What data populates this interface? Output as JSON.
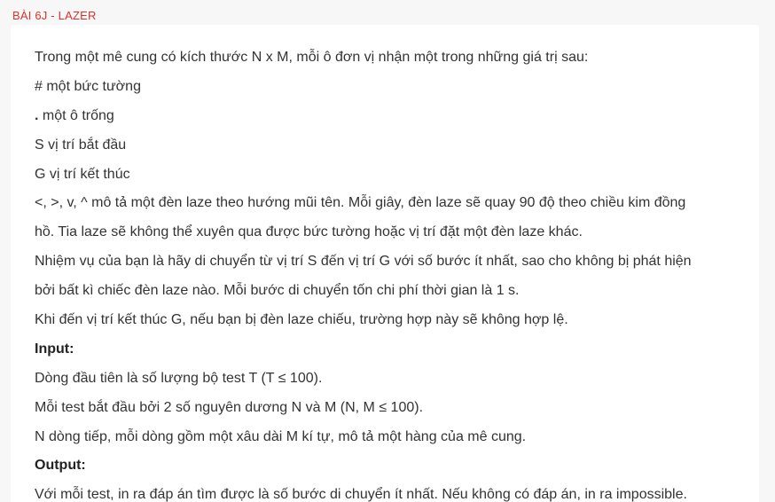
{
  "title": "BÀI 6J - LAZER",
  "lines": {
    "l0": "Trong một mê cung có kích thước N x M, mỗi ô đơn vị nhận một trong những giá trị sau:",
    "l1": "# một bức tường",
    "l2_symbol": ".",
    "l2_text": " một ô trống",
    "l3": "S vị trí bắt đầu",
    "l4": "G vị trí kết thúc",
    "l5": "<, >, v, ^ mô tả một đèn laze theo hướng mũi tên. Mỗi giây, đèn laze sẽ quay 90 độ theo chiều kim đồng",
    "l6": "hồ. Tia laze sẽ không thể xuyên qua được bức tường hoặc vị trí đặt một đèn laze khác.",
    "l7": "Nhiệm vụ của bạn là hãy di chuyển từ vị trí S đến vị trí G với số bước ít nhất, sao cho không bị phát hiện",
    "l8": "bởi bất kì chiếc đèn laze nào. Mỗi bước di chuyển tốn chi phí thời gian là 1 s.",
    "l9": "Khi đến vị trí kết thúc G, nếu bạn bị đèn laze chiếu, trường hợp này sẽ không hợp lệ.",
    "l10": "Input:",
    "l11": "Dòng đầu tiên là số lượng bộ test T (T ≤ 100).",
    "l12": "Mỗi test bắt đầu bởi 2 số nguyên dương N và M (N, M ≤ 100).",
    "l13": "N dòng tiếp, mỗi dòng gồm một xâu dài M kí tự, mô tả một hàng của mê cung.",
    "l14": "Output:",
    "l15": "Với mỗi test, in ra đáp án tìm được là số bước di chuyển ít nhất. Nếu không có đáp án, in ra impossible."
  },
  "colors": {
    "title": "#d9342b",
    "text": "#333333",
    "background": "#f7f7f7",
    "card": "#ffffff"
  }
}
